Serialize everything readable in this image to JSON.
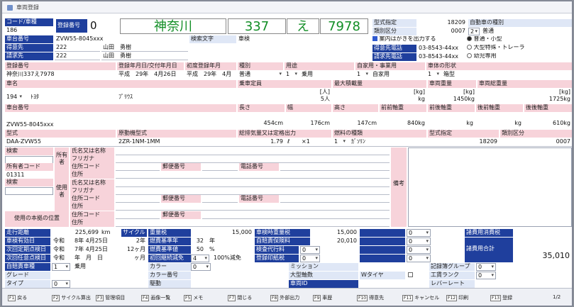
{
  "window": {
    "title": "車両登録",
    "page": "1/2"
  },
  "top": {
    "code_label": "コード/車種",
    "code_value": "186",
    "reg_no_label": "登録番号",
    "reg_no_digit": "0",
    "plate_area": "神奈川",
    "plate_class": "337",
    "plate_kana": "え",
    "plate_number": "7978",
    "model_spec_label": "型式指定",
    "model_spec_value": "18209",
    "class_div_label": "類別区分",
    "class_div_value": "0007",
    "class_div_code": "2",
    "auto_type_label": "自動車の種別",
    "auto_type_value": "普通",
    "car_name_label": "車台番号",
    "car_name_value": "ZVW55-8045xxx",
    "search_text_label": "検索文字",
    "search_text_value": "車検",
    "notice_label": "案内はがきを出力する",
    "opt_normal": "普通・小型",
    "opt_large": "大型特殊・トレーラ",
    "opt_child": "幼児専用",
    "customer_label": "得意先",
    "customer_code": "222",
    "customer_name": "山田　勇樹",
    "customer_tel_label": "得意先電話",
    "customer_tel": "03-8543-44xx",
    "billing_label": "請求先",
    "billing_code": "222",
    "billing_name": "山田　勇樹",
    "billing_tel_label": "請求先電話",
    "billing_tel": "03-8543-44xx"
  },
  "reg": {
    "reg_no_label": "登録番号",
    "reg_no": "神奈川337え7978",
    "reg_date_label": "登録年月日/交付年月日",
    "reg_date": "平成　29年　4月26日",
    "first_reg_label": "初度登録年月",
    "first_reg": "平成　29年　4月",
    "kind_label": "種別",
    "kind": "普通",
    "use_label": "用途",
    "use_code": "1",
    "use": "乗用",
    "biz_label": "自家用・事業用",
    "biz_code": "1",
    "biz": "自家用",
    "shape_label": "車体の形状",
    "shape_code": "1",
    "shape": "箱型"
  },
  "car": {
    "name_label": "車名",
    "name_code": "194",
    "name": "ﾄﾖﾀ",
    "model_name": "ﾌﾟﾘｳｽ",
    "capacity_label": "乗車定員",
    "capacity_unit": "[人]",
    "capacity": "5人",
    "max_load_label": "最大積載量",
    "max_load_unit": "[kg]",
    "max_load": "kg",
    "weight_label": "車両重量",
    "weight_unit": "[kg]",
    "weight": "1450kg",
    "gross_label": "車両総重量",
    "gross_unit": "[kg]",
    "gross": "1725kg"
  },
  "chassis": {
    "label": "車台番号",
    "value": "ZVW55-8045xxx",
    "length_label": "長さ",
    "length": "454cm",
    "width_label": "幅",
    "width": "176cm",
    "height_label": "高さ",
    "height": "147cm",
    "ff_label": "前前軸重",
    "ff": "840kg",
    "fr_label": "前後軸重",
    "fr": "kg",
    "rf_label": "後前軸重",
    "rf": "kg",
    "rr_label": "後後軸重",
    "rr": "610kg"
  },
  "engine": {
    "model_label": "型式",
    "model": "DAA-ZVW55",
    "engine_label": "原動機型式",
    "engine": "2ZR-1NM-1MM",
    "disp_label": "総排気量又は定格出力",
    "disp": "1.79",
    "disp_unit": "ℓ",
    "disp_mult": "×1",
    "fuel_label": "燃料の種類",
    "fuel_code": "1",
    "fuel": "ｶﾞｿﾘﾝ",
    "spec_label": "型式指定",
    "spec": "18209",
    "class_label": "類別区分",
    "class": "0007"
  },
  "owner": {
    "search_label": "検索",
    "owner_vert": "所有者",
    "name_label": "氏名又は名称",
    "kana_label": "フリガナ",
    "code_label": "所有者コード",
    "code": "01311",
    "addr_code_label": "住所コード",
    "zip_label": "郵便番号",
    "tel_label": "電話番号",
    "addr_label": "住所",
    "user_search_label": "検索",
    "user_vert": "使用者",
    "base_label": "使用の本拠の位置",
    "base_addr_code_label": "住所コード",
    "base_zip_label": "郵便番号",
    "base_addr_label": "住所",
    "remarks_label": "備考"
  },
  "bottom": {
    "mileage_label": "走行距離",
    "mileage": "225,699",
    "mileage_unit": "km",
    "cycle_label": "サイクル",
    "weight_tax_label": "重量税",
    "weight_tax": "15,000",
    "insp_weight_tax_label": "車検時重量税",
    "insp_weight_tax": "15,000",
    "insp_valid_label": "車検有効日",
    "insp_valid_era": "令和",
    "insp_valid": "8年 4月25日",
    "cycle_years": "2年",
    "fuel_std_year_label": "燃費基準年",
    "fuel_std_year": "32",
    "fuel_std_year_unit": "年",
    "liability_label": "自賠責保険料",
    "liability": "20,010",
    "next_insp_label": "次回定期点検日",
    "next_insp_era": "令和",
    "next_insp": "7年 4月25日",
    "next_insp_cycle": "12ヶ月",
    "fuel_std_label": "燃費基準値",
    "fuel_std": "50",
    "fuel_std_unit": "%",
    "agency_label": "検査代行料",
    "agency_code": "0",
    "next_any_label": "次回任意点検日",
    "next_any_era": "令和",
    "next_any": "年　月　日",
    "next_any_unit": "ヶ月",
    "first_reduce_label": "初回継続減免",
    "first_reduce_code": "4",
    "first_reduce": "100%減免",
    "stamp_label": "登録印紙税",
    "stamp_code": "0",
    "liab_car_label": "自賠責車種",
    "liab_car_code": "1",
    "liab_car": "乗用",
    "color_label": "カラー",
    "color_code": "0",
    "mission_label": "ミッション",
    "record_group_label": "記録簿グループ",
    "record_group_code": "0",
    "grade_label": "グレード",
    "color_no_label": "カラー番号",
    "axles_label": "大型軸数",
    "wtire_label": "Wタイヤ",
    "labor_rank_label": "工賃ランク",
    "labor_rank_code": "0",
    "type_label": "タイプ",
    "type_code": "0",
    "drive_label": "駆動",
    "vehicle_id_label": "車両ID",
    "lever_label": "レバーレート",
    "blue_codes": [
      "0",
      "0",
      "0",
      "0"
    ],
    "fees_label": "諸費用消費税",
    "total_label": "諸費用合計",
    "total": "35,010"
  },
  "footer": {
    "keys": [
      {
        "k": "F1",
        "t": "戻る"
      },
      {
        "k": "F2",
        "t": "サイクル算出"
      },
      {
        "k": "F3",
        "t": "管理項目"
      },
      {
        "k": "F4",
        "t": "画像一覧"
      },
      {
        "k": "F5",
        "t": "メモ"
      },
      {
        "k": "F7",
        "t": "閉じる"
      },
      {
        "k": "F8",
        "t": "外部出力"
      },
      {
        "k": "F9",
        "t": "車歴"
      },
      {
        "k": "F10",
        "t": "得意先"
      },
      {
        "k": "F11",
        "t": "キャンセル"
      },
      {
        "k": "F12",
        "t": "印刷"
      },
      {
        "k": "F13",
        "t": "登録"
      }
    ]
  }
}
